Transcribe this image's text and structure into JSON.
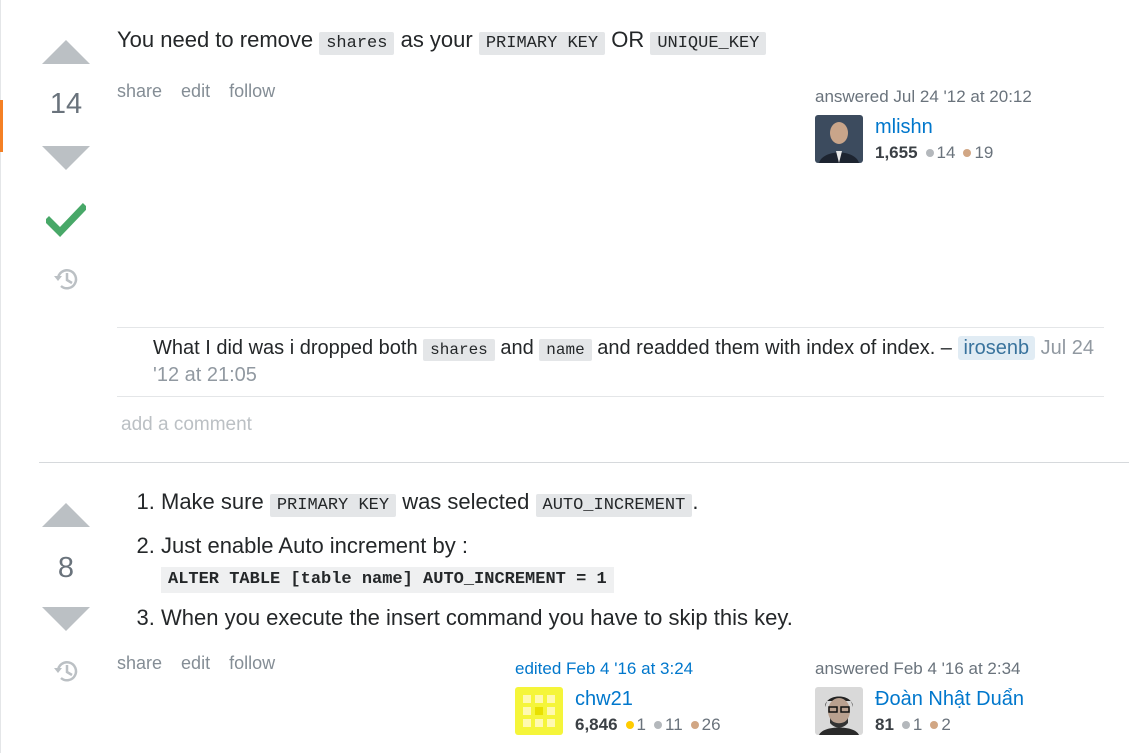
{
  "answers": [
    {
      "votes": "14",
      "body": {
        "prefix": "You need to remove",
        "code1": "shares",
        "middle": "as your",
        "code2": "PRIMARY KEY",
        "or": "OR",
        "code3": "UNIQUE_KEY"
      },
      "menu": {
        "share": "share",
        "edit": "edit",
        "follow": "follow"
      },
      "answered": {
        "when": "answered Jul 24 '12 at 20:12",
        "user": "mlishn",
        "reputation": "1,655",
        "silver": "14",
        "bronze": "19"
      },
      "comment": {
        "text1": "What I did was i dropped both",
        "code1": "shares",
        "text2": "and",
        "code2": "name",
        "text3": "and readded them with index of index. –",
        "user": "irosenb",
        "date": "Jul 24 '12 at 21:05"
      },
      "add_comment": "add a comment"
    },
    {
      "votes": "8",
      "steps": [
        {
          "text1": "Make sure",
          "code1": "PRIMARY KEY",
          "text2": "was selected",
          "code2": "AUTO_INCREMENT",
          "end": "."
        },
        {
          "text1": "Just enable Auto increment by :",
          "code": "ALTER TABLE [table name] AUTO_INCREMENT = 1"
        },
        {
          "text1": "When you execute the insert command you have to skip this key."
        }
      ],
      "menu": {
        "share": "share",
        "edit": "edit",
        "follow": "follow"
      },
      "edited": {
        "when": "edited Feb 4 '16 at 3:24",
        "user": "chw21",
        "reputation": "6,846",
        "gold": "1",
        "silver": "11",
        "bronze": "26"
      },
      "answered": {
        "when": "answered Feb 4 '16 at 2:34",
        "user": "Đoàn Nhật Duẩn",
        "reputation": "81",
        "silver": "1",
        "bronze": "2"
      }
    }
  ],
  "colors": {
    "link": "#0077cc",
    "accepted": "#48a868",
    "vote_arrow": "#bbc0c4",
    "accent_bar": "#f48024"
  },
  "icons": [
    "vote-up-icon",
    "vote-down-icon",
    "accepted-check-icon",
    "history-icon"
  ]
}
